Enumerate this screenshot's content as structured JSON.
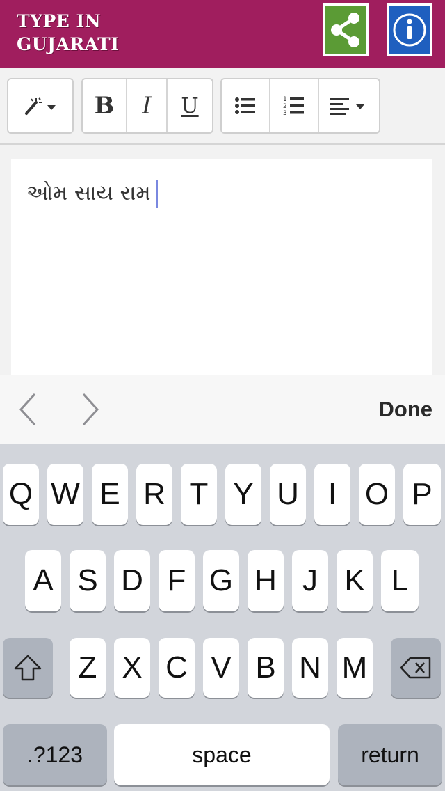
{
  "header": {
    "title": "TYPE IN GUJARATI",
    "share_icon": "share-icon",
    "info_icon": "info-icon",
    "accent": "#a01e5e"
  },
  "toolbar": {
    "style_icon": "magic-wand-icon",
    "bold_label": "B",
    "italic_label": "I",
    "underline_label": "U",
    "unordered_list_icon": "bullet-list-icon",
    "ordered_list_icon": "numbered-list-icon",
    "align_icon": "align-left-icon"
  },
  "editor": {
    "text": "ઓમ સાય રામ"
  },
  "accessory": {
    "prev_icon": "chevron-left-icon",
    "next_icon": "chevron-right-icon",
    "done_label": "Done"
  },
  "keyboard": {
    "row1": [
      "Q",
      "W",
      "E",
      "R",
      "T",
      "Y",
      "U",
      "I",
      "O",
      "P"
    ],
    "row2": [
      "A",
      "S",
      "D",
      "F",
      "G",
      "H",
      "J",
      "K",
      "L"
    ],
    "row3": [
      "Z",
      "X",
      "C",
      "V",
      "B",
      "N",
      "M"
    ],
    "shift_icon": "shift-icon",
    "backspace_icon": "backspace-icon",
    "numbers_label": ".?123",
    "space_label": "space",
    "return_label": "return"
  }
}
